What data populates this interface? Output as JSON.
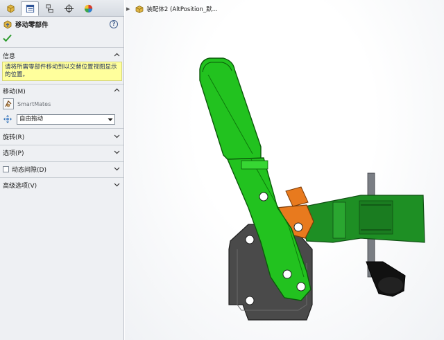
{
  "property_manager": {
    "tabs": [
      {
        "name": "feature-manager-tab",
        "icon": "assembly-icon"
      },
      {
        "name": "property-manager-tab",
        "icon": "properties-icon"
      },
      {
        "name": "configuration-manager-tab",
        "icon": "configuration-icon"
      },
      {
        "name": "dimxpert-tab",
        "icon": "crosshair-icon"
      },
      {
        "name": "display-manager-tab",
        "icon": "appearance-icon"
      }
    ],
    "title": "移动零部件",
    "help_icon": "?",
    "info": {
      "header": "信息",
      "message": "请将所需零部件移动到以交替位置视图显示的位置。"
    },
    "move": {
      "header": "移动(M)",
      "smartmates_label": "SmartMates",
      "mode_value": "自由拖动"
    },
    "rotate_header": "旋转(R)",
    "options_header": "选项(P)",
    "dynamic_clearance_header": "动态间隙(D)",
    "advanced_header": "高级选项(V)"
  },
  "graphics": {
    "tree_label": "装配体2  (AltPosition_默..."
  },
  "colors": {
    "info_background": "#ffff9c",
    "link_green": "#22c21f",
    "base_gray": "#4a4a4a",
    "orange_part": "#e87a1e",
    "body_green": "#1e8f24",
    "ok_green": "#2d9b2d"
  }
}
